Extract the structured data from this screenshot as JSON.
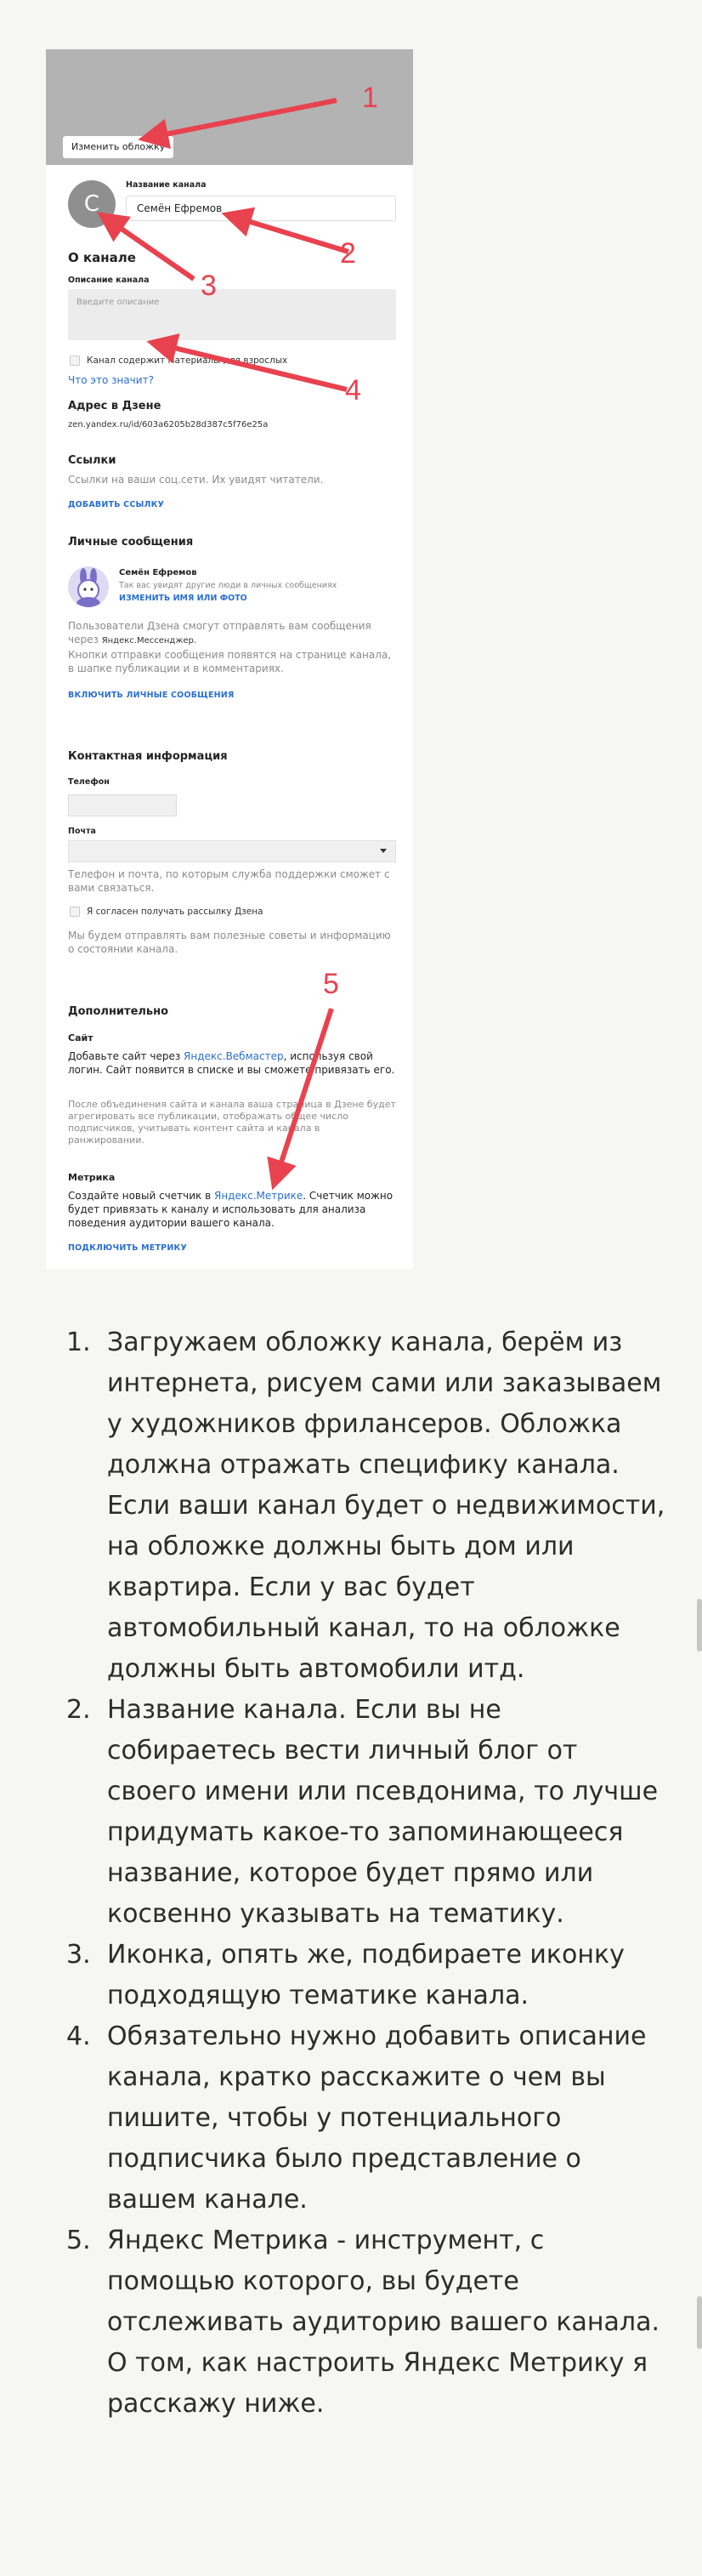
{
  "form": {
    "cover_button": "Изменить обложку",
    "avatar_letter": "С",
    "channel_name_label": "Название канала",
    "channel_name_value": "Семён Ефремов",
    "about_title": "О канале",
    "description_label": "Описание канала",
    "description_placeholder": "Введите описание",
    "mature_checkbox_label": "Канал содержит материалы для взрослых",
    "what_is_it_link": "Что это значит?",
    "zen_address_label": "Адрес в Дзене",
    "zen_address_value": "zen.yandex.ru/id/603a6205b28d387c5f76e25a",
    "links_title": "Ссылки",
    "links_hint": "Ссылки на ваши соц.сети. Их увидят читатели.",
    "add_link": "ДОБАВИТЬ ССЫЛКУ",
    "pm_title": "Личные сообщения",
    "pm_name": "Семён Ефремов",
    "pm_hint": "Так вас увидят другие люди в личных сообщениях",
    "pm_change_link": "ИЗМЕНИТЬ ИМЯ ИЛИ ФОТО",
    "pm_text_1": "Пользователи Дзена смогут отправлять вам сообщения через",
    "pm_messenger": "Яндекс.Мессенджер.",
    "pm_text_2": "Кнопки отправки сообщения появятся на странице канала, в шапке публикации и в комментариях.",
    "pm_enable": "ВКЛЮЧИТЬ ЛИЧНЫЕ СООБЩЕНИЯ",
    "contact_title": "Контактная информация",
    "phone_label": "Телефон",
    "mail_label": "Почта",
    "contact_hint": "Телефон и почта, по которым служба поддержки сможет с вами связаться.",
    "newsletter_label": "Я согласен получать рассылку Дзена",
    "newsletter_hint": "Мы будем отправлять вам полезные советы и информацию о состоянии канала.",
    "extra_title": "Дополнительно",
    "site_title": "Сайт",
    "site_text_pre": "Добавьте сайт через",
    "site_link": "Яндекс.Вебмастер",
    "site_text_post": ", используя свой логин. Сайт появится в списке и вы сможете привязать его.",
    "site_hint": "После объединения сайта и канала ваша страница в Дзене будет агрегировать все публикации, отображать общее число подписчиков, учитывать контент сайта и канала в ранжировании.",
    "metrika_title": "Метрика",
    "metrika_text_pre": "Создайте новый счетчик в",
    "metrika_link": "Яндекс.Метрике",
    "metrika_text_post": ". Счетчик можно будет привязать к каналу и использовать для анализа поведения аудитории вашего канала.",
    "metrika_connect": "ПОДКЛЮЧИТЬ МЕТРИКУ"
  },
  "annotations": {
    "numbers": [
      "1",
      "2",
      "3",
      "4",
      "5"
    ],
    "color": "#e8424f"
  },
  "article": {
    "items": [
      {
        "num": "1.",
        "text": "Загружаем обложку канала, берём из интернета, рисуем сами или заказываем у художников фрилансеров. Обложка должна отражать специфику канала. Если ваши канал будет о недвижимости, на обложке должны быть дом или квартира. Если у вас будет автомобильный канал, то на обложке должны быть автомобили итд."
      },
      {
        "num": "2.",
        "text": "Название канала. Если вы не собираетесь вести личный блог от своего имени или псевдонима, то лучше придумать какое-то запоминающееся название, которое будет прямо или косвенно указывать на тематику."
      },
      {
        "num": "3.",
        "text": "Иконка, опять же, подбираете иконку подходящую тематике канала."
      },
      {
        "num": "4.",
        "text": "Обязательно нужно добавить описание канала, кратко расскажите о чем вы пишите, чтобы у потенциального подписчика было представление о вашем канале."
      },
      {
        "num": "5.",
        "text": "Яндекс Метрика - инструмент, с помощью которого, вы будете отслеживать аудиторию вашего канала. О том, как настроить Яндекс Метрику я расскажу ниже."
      }
    ]
  }
}
